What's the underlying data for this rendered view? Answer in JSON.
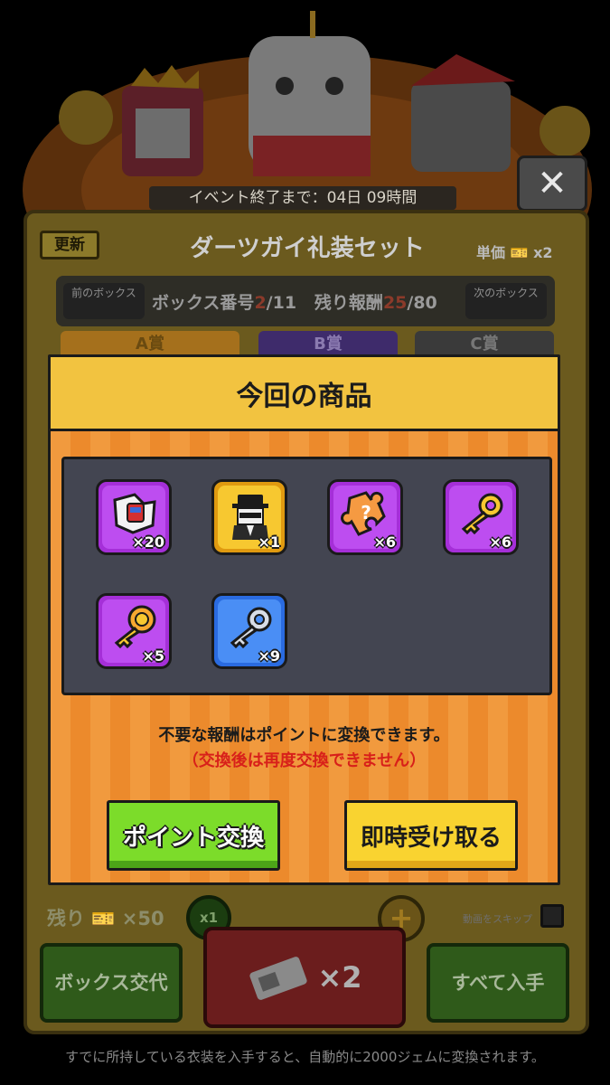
{
  "event": {
    "timer": "イベント終了まで：04日 09時間"
  },
  "panel": {
    "refresh_label": "更新",
    "title": "ダーツガイ礼装セット",
    "unit_price": "単価",
    "unit_price_mult": "x2",
    "prev_box": "前のボックス",
    "next_box": "次のボックス",
    "box_number_label": "ボックス番号",
    "box_number_current": "2",
    "box_number_total": "/11",
    "remaining_label": "残り報酬",
    "remaining_current": "25",
    "remaining_total": "/80",
    "tabs": [
      "A賞",
      "B賞",
      "C賞"
    ],
    "remaining_tickets": "残り",
    "remaining_tickets_mult": "×50",
    "mult_selector": "x1",
    "skip_label": "動画をスキップ",
    "box_swap_label": "ボックス交代",
    "draw_mult": "×2",
    "get_all_label": "すべて入手",
    "footer_note": "すでに所持している衣装を入手すると、自動的に2000ジェムに変換されます。"
  },
  "modal": {
    "title": "今回の商品",
    "rewards": [
      {
        "icon": "character-piece-icon",
        "count": "×20",
        "rarity": "purple"
      },
      {
        "icon": "agent-costume-icon",
        "count": "×1",
        "rarity": "gold"
      },
      {
        "icon": "mystery-puzzle-piece-icon",
        "count": "×6",
        "rarity": "purple"
      },
      {
        "icon": "gold-key-icon",
        "count": "×6",
        "rarity": "purple"
      },
      {
        "icon": "gold-lion-key-icon",
        "count": "×5",
        "rarity": "purple"
      },
      {
        "icon": "silver-key-icon",
        "count": "×9",
        "rarity": "blue"
      }
    ],
    "info": "不要な報酬はポイントに変換できます。",
    "warning": "（交換後は再度交換できません）",
    "convert_button": "ポイント交換",
    "claim_button": "即時受け取る"
  },
  "colors": {
    "modal_header": "#f2c340",
    "modal_stripe_a": "#f19a3e",
    "modal_stripe_b": "#ec8a2c",
    "warning": "#d8201a",
    "green_button": "#7cdc2a",
    "yellow_button": "#f9d330"
  }
}
